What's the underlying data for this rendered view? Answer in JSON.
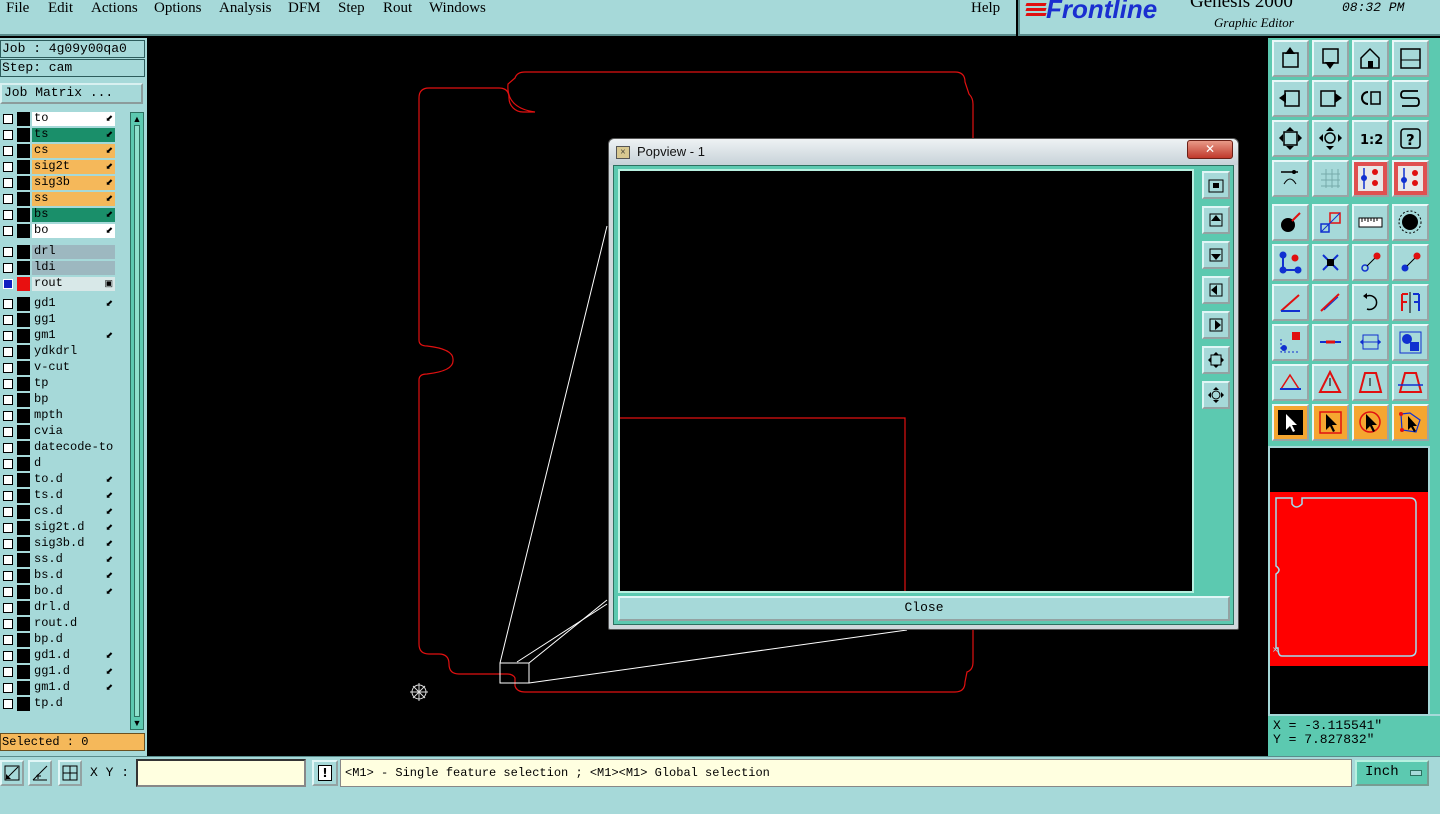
{
  "menubar": {
    "items": [
      {
        "label": "File",
        "key": "F"
      },
      {
        "label": "Edit",
        "key": "E"
      },
      {
        "label": "Actions",
        "key": "A"
      },
      {
        "label": "Options",
        "key": "O"
      },
      {
        "label": "Analysis",
        "key": "A"
      },
      {
        "label": "DFM",
        "key": "D"
      },
      {
        "label": "Step",
        "key": "S"
      },
      {
        "label": "Rout",
        "key": "R"
      },
      {
        "label": "Windows",
        "key": "W"
      }
    ],
    "help": "Help"
  },
  "brand": {
    "logo": "Frontline",
    "product": "Genesis 2000",
    "subtitle": "Graphic Editor",
    "clock": "08:32 PM"
  },
  "job": {
    "job_line": "Job : 4g09y00qa0",
    "step_line": "Step: cam",
    "matrix_button": "Job Matrix ..."
  },
  "layers": [
    {
      "name": "to",
      "color": "#ffffff",
      "flag": "⬋"
    },
    {
      "name": "ts",
      "color": "#1a8f6a",
      "flag": "⬋"
    },
    {
      "name": "cs",
      "color": "#f5b85a",
      "flag": "⬋"
    },
    {
      "name": "sig2t",
      "color": "#f5b85a",
      "flag": "⬋"
    },
    {
      "name": "sig3b",
      "color": "#f5b85a",
      "flag": "⬋"
    },
    {
      "name": "ss",
      "color": "#f5b85a",
      "flag": "⬋"
    },
    {
      "name": "bs",
      "color": "#1a8f6a",
      "flag": "⬋"
    },
    {
      "name": "bo",
      "color": "#ffffff",
      "flag": "⬋"
    },
    {
      "name": "drl",
      "color": "#9db8c0",
      "flag": ""
    },
    {
      "name": "ldi",
      "color": "#9db8c0",
      "flag": ""
    },
    {
      "name": "rout",
      "color": "#d8e8e8",
      "flag": "▣",
      "active": true
    },
    {
      "name": "gd1",
      "color": "#a6d9d9",
      "flag": "⬋"
    },
    {
      "name": "gg1",
      "color": "#a6d9d9",
      "flag": ""
    },
    {
      "name": "gm1",
      "color": "#a6d9d9",
      "flag": "⬋"
    },
    {
      "name": "ydkdrl",
      "color": "#a6d9d9",
      "flag": ""
    },
    {
      "name": "v-cut",
      "color": "#a6d9d9",
      "flag": ""
    },
    {
      "name": "tp",
      "color": "#a6d9d9",
      "flag": ""
    },
    {
      "name": "bp",
      "color": "#a6d9d9",
      "flag": ""
    },
    {
      "name": "mpth",
      "color": "#a6d9d9",
      "flag": ""
    },
    {
      "name": "cvia",
      "color": "#a6d9d9",
      "flag": ""
    },
    {
      "name": "datecode-to",
      "color": "#a6d9d9",
      "flag": ""
    },
    {
      "name": "d",
      "color": "#a6d9d9",
      "flag": ""
    },
    {
      "name": "to.d",
      "color": "#a6d9d9",
      "flag": "⬋"
    },
    {
      "name": "ts.d",
      "color": "#a6d9d9",
      "flag": "⬋"
    },
    {
      "name": "cs.d",
      "color": "#a6d9d9",
      "flag": "⬋"
    },
    {
      "name": "sig2t.d",
      "color": "#a6d9d9",
      "flag": "⬋"
    },
    {
      "name": "sig3b.d",
      "color": "#a6d9d9",
      "flag": "⬋"
    },
    {
      "name": "ss.d",
      "color": "#a6d9d9",
      "flag": "⬋"
    },
    {
      "name": "bs.d",
      "color": "#a6d9d9",
      "flag": "⬋"
    },
    {
      "name": "bo.d",
      "color": "#a6d9d9",
      "flag": "⬋"
    },
    {
      "name": "drl.d",
      "color": "#a6d9d9",
      "flag": ""
    },
    {
      "name": "rout.d",
      "color": "#a6d9d9",
      "flag": ""
    },
    {
      "name": "bp.d",
      "color": "#a6d9d9",
      "flag": ""
    },
    {
      "name": "gd1.d",
      "color": "#a6d9d9",
      "flag": "⬋"
    },
    {
      "name": "gg1.d",
      "color": "#a6d9d9",
      "flag": "⬋"
    },
    {
      "name": "gm1.d",
      "color": "#a6d9d9",
      "flag": "⬋"
    },
    {
      "name": "tp.d",
      "color": "#a6d9d9",
      "flag": ""
    }
  ],
  "selected": "Selected : 0",
  "popview": {
    "title": "Popview - 1",
    "close_x": "✕",
    "close_button": "Close"
  },
  "coords": {
    "x": "X = -3.115541\"",
    "y": "Y = 7.827832\""
  },
  "status": {
    "xy_label": "X Y :",
    "xy_value": "",
    "bang": "!",
    "hint": "<M1> - Single feature selection ; <M1><M1> Global selection",
    "unit": "Inch"
  },
  "colors": {
    "panel": "#a6d9d9",
    "panel_dark": "#5cc9b0",
    "rout_outline": "#e01010",
    "minimap_fill": "#ff0000"
  }
}
